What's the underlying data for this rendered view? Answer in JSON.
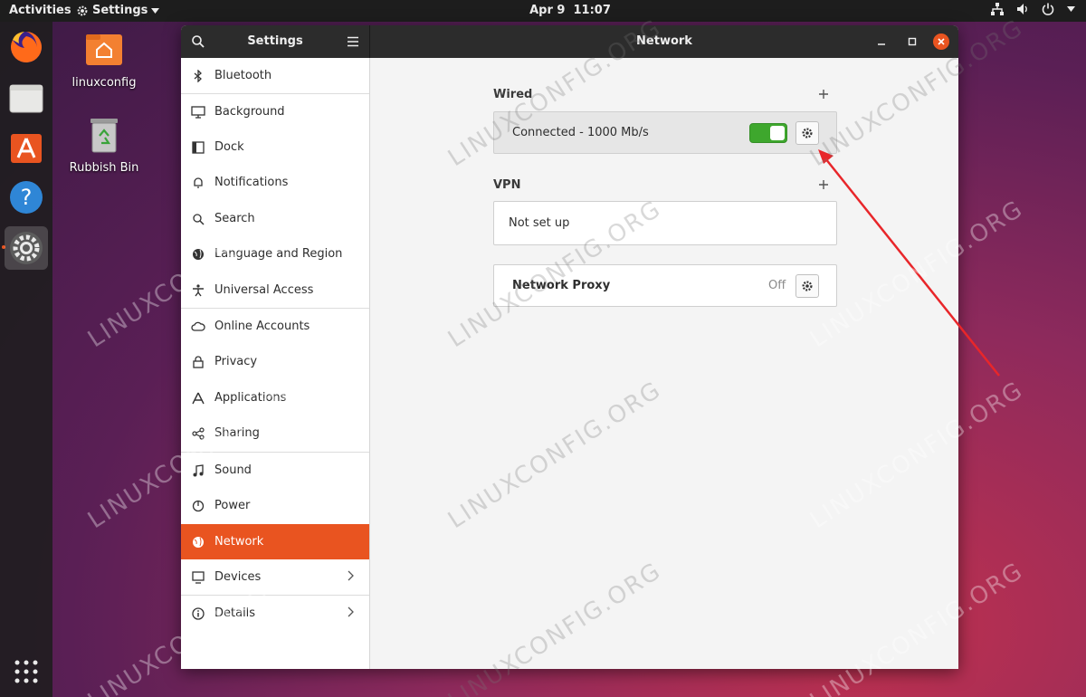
{
  "topbar": {
    "activities": "Activities",
    "app_menu": "Settings",
    "clock_date": "Apr 9",
    "clock_time": "11:07"
  },
  "desktop": {
    "home_label": "linuxconfig",
    "trash_label": "Rubbish Bin"
  },
  "window": {
    "sidebar_title": "Settings",
    "main_title": "Network"
  },
  "sidebar": {
    "items": [
      {
        "label": "Bluetooth",
        "icon": "bluetooth-icon"
      },
      {
        "label": "Background",
        "icon": "monitor-icon"
      },
      {
        "label": "Dock",
        "icon": "dock-icon"
      },
      {
        "label": "Notifications",
        "icon": "bell-icon"
      },
      {
        "label": "Search",
        "icon": "search-icon"
      },
      {
        "label": "Language and Region",
        "icon": "globe-icon"
      },
      {
        "label": "Universal Access",
        "icon": "accessibility-icon"
      },
      {
        "label": "Online Accounts",
        "icon": "cloud-icon"
      },
      {
        "label": "Privacy",
        "icon": "lock-icon"
      },
      {
        "label": "Applications",
        "icon": "applications-icon"
      },
      {
        "label": "Sharing",
        "icon": "share-icon"
      },
      {
        "label": "Sound",
        "icon": "music-note-icon"
      },
      {
        "label": "Power",
        "icon": "power-icon"
      },
      {
        "label": "Network",
        "icon": "network-globe-icon"
      },
      {
        "label": "Devices",
        "icon": "devices-icon"
      },
      {
        "label": "Details",
        "icon": "info-icon"
      }
    ],
    "selected": "Network"
  },
  "network": {
    "wired_title": "Wired",
    "wired_status": "Connected - 1000 Mb/s",
    "wired_enabled": true,
    "vpn_title": "VPN",
    "vpn_status": "Not set up",
    "proxy_title": "Network Proxy",
    "proxy_status": "Off"
  },
  "watermark": "LINUXCONFIG.ORG",
  "colors": {
    "accent": "#e95420",
    "toggle_on": "#3ea72d",
    "arrow": "#e8262a"
  }
}
